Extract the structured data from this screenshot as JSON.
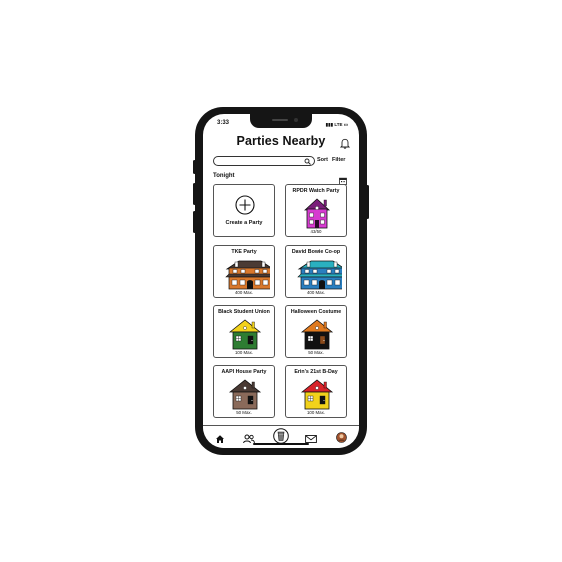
{
  "status_bar": {
    "time": "3:33",
    "signal": "LTE"
  },
  "header": {
    "title": "Parties Nearby"
  },
  "search": {
    "placeholder": "",
    "sort_label": "Sort",
    "filter_label": "Filter"
  },
  "section": {
    "label": "Tonight"
  },
  "create_card": {
    "label": "Create a Party"
  },
  "parties": [
    {
      "name": "RPDR Watch Party",
      "capacity": "43/50",
      "house_color": "#d63bd0",
      "roof_color": "#7a1f7a",
      "style": "tall"
    },
    {
      "name": "TKE Party",
      "capacity": "400 Max.",
      "house_color": "#d9782c",
      "roof_color": "#4a3b34",
      "style": "mansion"
    },
    {
      "name": "David Bowie Co-op",
      "capacity": "400 Max.",
      "house_color": "#2a7fc0",
      "roof_color": "#2ab0c0",
      "style": "mansion"
    },
    {
      "name": "Black Student Union",
      "capacity": "100 Max.",
      "house_color": "#2e7d32",
      "roof_color": "#f2d21b",
      "style": "basic"
    },
    {
      "name": "Halloween Costume",
      "capacity": "50 Max.",
      "house_color": "#111111",
      "roof_color": "#e07a1f",
      "style": "basic"
    },
    {
      "name": "AAPI House Party",
      "capacity": "50 Max.",
      "house_color": "#8a6a5a",
      "roof_color": "#4a3a34",
      "style": "basic"
    },
    {
      "name": "Erin's 21st B-Day",
      "capacity": "100 Max.",
      "house_color": "#f2d21b",
      "roof_color": "#d8232a",
      "style": "basic"
    }
  ],
  "nav": [
    "home-icon",
    "people-icon",
    "cup-icon",
    "mail-icon",
    "profile-avatar"
  ]
}
